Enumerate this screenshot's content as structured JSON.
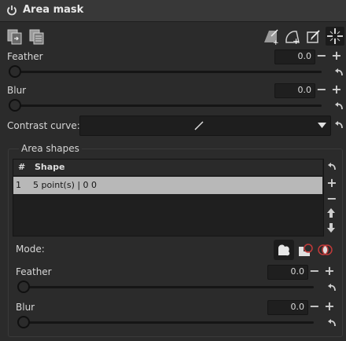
{
  "header": {
    "title": "Area mask",
    "power_icon": "power-icon"
  },
  "toolbar": {
    "left_icons": [
      "copy-icon",
      "paste-icon"
    ],
    "right_icons": [
      "add-polygon-icon",
      "add-spline-icon",
      "edit-shape-icon",
      "move-crosshair-icon"
    ]
  },
  "feather": {
    "label": "Feather",
    "value": "0.0",
    "level": 0
  },
  "blur": {
    "label": "Blur",
    "value": "0.0",
    "level": 0
  },
  "contrast": {
    "label": "Contrast curve:"
  },
  "area_shapes": {
    "title": "Area shapes",
    "columns": [
      "#",
      "Shape"
    ],
    "rows": [
      {
        "num": "1",
        "shape": "5 point(s) | 0 0"
      }
    ],
    "mode_label": "Mode:",
    "feather": {
      "label": "Feather",
      "value": "0.0",
      "level": 0
    },
    "blur": {
      "label": "Blur",
      "value": "0.0",
      "level": 0
    }
  },
  "symbols": {
    "minus": "−",
    "plus": "+"
  },
  "colors": {
    "accent_red": "#c23a3a",
    "selection": "#b8b8b8"
  }
}
